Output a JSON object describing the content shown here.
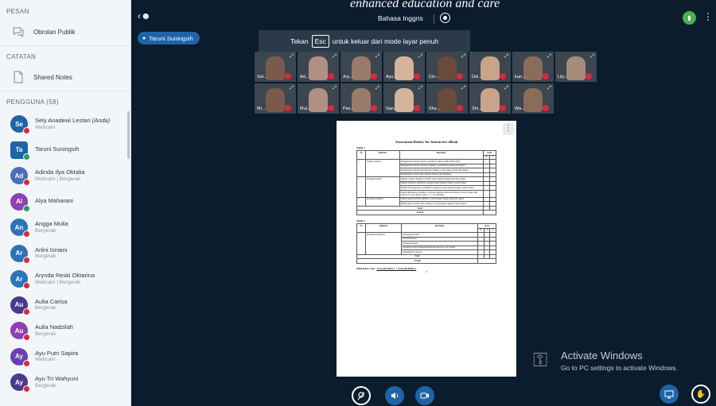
{
  "sidebar": {
    "messages_title": "PESAN",
    "public_chat_label": "Obrolan Publik",
    "notes_title": "CATATAN",
    "shared_notes_label": "Shared Notes",
    "users_title": "PENGGUNA (58)",
    "users": [
      {
        "initials": "Se",
        "name": "Sely Anadewi Lestari",
        "you": "(Anda)",
        "status": "Webcam",
        "color": "#1f64a8"
      },
      {
        "initials": "Ta",
        "name": "Taruni Suningsih",
        "you": "",
        "status": "",
        "color": "#1f64a8"
      },
      {
        "initials": "Ad",
        "name": "Adinda Ilya Oktalia",
        "you": "",
        "status": "Webcam | Bergerak",
        "color": "#4a6fb5"
      },
      {
        "initials": "Al",
        "name": "Alya Maharani",
        "you": "",
        "status": "",
        "color": "#8e3fb0"
      },
      {
        "initials": "An",
        "name": "Angga Mulia",
        "you": "",
        "status": "Bergerak",
        "color": "#2c73b8"
      },
      {
        "initials": "Ar",
        "name": "Arlini Isnaini",
        "you": "",
        "status": "Bergerak",
        "color": "#2c73b8"
      },
      {
        "initials": "Ar",
        "name": "Arynda Reski Oktarina",
        "you": "",
        "status": "Webcam | Bergerak",
        "color": "#2c73b8"
      },
      {
        "initials": "Au",
        "name": "Aulia Carisa",
        "you": "",
        "status": "Bergerak",
        "color": "#4b3a8c"
      },
      {
        "initials": "Au",
        "name": "Aulia Nadzilah",
        "you": "",
        "status": "Bergerak",
        "color": "#8e3fb0"
      },
      {
        "initials": "Ay",
        "name": "Ayu Putri Sapira",
        "you": "",
        "status": "Webcam",
        "color": "#6a3fb0"
      },
      {
        "initials": "Ay",
        "name": "Ayu Tri Wahyuni",
        "you": "",
        "status": "Bergerak",
        "color": "#4b3a8c"
      }
    ]
  },
  "topbar": {
    "presenter": "Taruni Suningsih",
    "meeting_title": "Bahasa Inggris",
    "overlay_text": "enhanced education and care"
  },
  "fullscreen_banner": {
    "prefix": "Tekan",
    "key": "Esc",
    "suffix": "untuk keluar dari mode layar penuh"
  },
  "videos": {
    "row1": [
      "Sel...",
      "Ad...",
      "Ary...",
      "Ayu...",
      "Cin...",
      "Del...",
      "kun...",
      "Lily..."
    ],
    "row2": [
      "Mi...",
      "Mul...",
      "Pas...",
      "San...",
      "She...",
      "Shi...",
      "Wa..."
    ]
  },
  "document": {
    "title": "Assessment Rubric for Interactive eBook",
    "table1_label": "Table 1",
    "table2_label": "Table 2",
    "col_no": "No",
    "col_indicator": "Indicator",
    "col_descriptor": "Descriptor",
    "col_score": "Score",
    "score0": "0",
    "score1": "1",
    "score2": "2",
    "t1": [
      {
        "no": "1",
        "ind": "Sumber referensi",
        "desc": [
          "Menggunakan referensi terbaru, maksimal 5 tahun terakhir (2020-2025)",
          "Menggunakan referensi Nasional, minimal 2 pada masing-masing sub-chapter",
          "Menggunakan referensi Internasional, minimal 1 pada masing-masing sub-chapter",
          "Menggunakan citation style: APA/IR. Edition pada Mendeley"
        ]
      },
      {
        "no": "2",
        "ind": "Penyajian Konten",
        "desc": [
          "Memuat Content, minimal 5 paragraf yang berkaitan dengan judul sub-chapter",
          "Memuat Summary, maksimal 1 paragraf yang berkaitan dengan content chapter",
          "Memuat Study Questions, maksimal 3 pertanyaan yang berkaitan dengan content chapter",
          "Memuat References, maksimal 5 referensi dikaitkan daftar sub-chapter (contoh: Chapter One terdiri dari 5 sub-chapter, maka 5 x 5 = 25 referensi)"
        ]
      },
      {
        "no": "3",
        "ind": "Penyajian Tampilan",
        "desc": [
          "Memuat gambar pribadi, minimal 1 yang berkaitan dengan judul sub-chapter",
          "Memuat QR Code link video, minimal 1 yang berkaitan dengan content chapter"
        ]
      }
    ],
    "total_label": "Total",
    "overall_label": "Overall",
    "t2_no": "1",
    "t2_ind": "Keruntutan Isi/Materi",
    "t2_desc": [
      "Kelengkapan materi",
      "Relevansi materi",
      "Kedalaman materi",
      "Keterkaitan materi dengan karakteristik anak usia 5 s.d. 6 tahun",
      "Kemutakhiran referensi"
    ],
    "nilai_prefix": "Nilai Rata-rata :",
    "nilai_formula": "Overall Table 1 + Overall Table 2",
    "nilai_divisor": "2"
  },
  "watermark": {
    "title": "Activate Windows",
    "subtitle": "Go to PC settings to activate Windows."
  }
}
